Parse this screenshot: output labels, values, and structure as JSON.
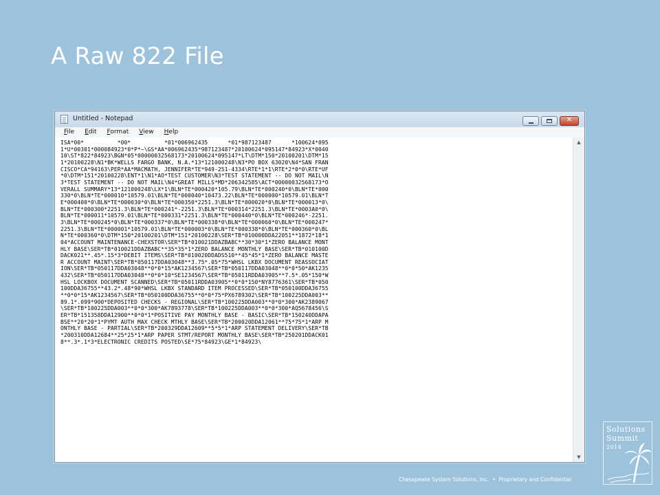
{
  "slide": {
    "title": "A Raw 822 File",
    "footer": {
      "company": "Chesapeake System Solutions, Inc.",
      "separator": "•",
      "note": "Proprietary and Confidential"
    },
    "logo": {
      "line1": "Solutions",
      "line2": "Summit",
      "year": "2014",
      "icon": "palm-tree-icon"
    },
    "background_color": "#9dc3dc"
  },
  "window": {
    "title": "Untitled - Notepad",
    "icons": {
      "app": "notepad-icon",
      "minimize": "minimize-icon",
      "maximize": "maximize-icon",
      "close": "close-icon"
    },
    "close_glyph": "✕",
    "menu": [
      {
        "accel": "F",
        "rest": "ile"
      },
      {
        "accel": "E",
        "rest": "dit"
      },
      {
        "accel": "F",
        "rest": "o",
        "after": "rmat",
        "accel_index": 1
      },
      {
        "accel": "V",
        "rest": "iew"
      },
      {
        "accel": "H",
        "rest": "elp"
      }
    ],
    "menu_labels": [
      "File",
      "Edit",
      "Format",
      "View",
      "Help"
    ],
    "scrollbar": {
      "up": "▲",
      "down": "▼"
    },
    "content_lines": [
      "ISA*00*          *00*          *01*006962435      *01*987123487      *100624*095",
      "1*U*00301*000084923*0*P*~\\GS*AA*006962435*987123487*20100624*095147*84923*X*0040",
      "10\\ST*822*84923\\BGN*05*00000032568173*20100624*095147*LT\\DTM*150*20100201\\DTM*15",
      "1*20100228\\N1*BK*WELLS FARGO BANK, N.A.*13*121000248\\N3*PO BOX 63020\\N4*SAN FRAN",
      "CISCO*CA*94163\\PER*AA*MACMATH, JENNIFER*TE*949-251-4334\\RTE*1*1\\RTE*2*0*0\\RTE*UF",
      "*0\\DTM*151*20100228\\ENT*1\\N1*AO*TEST CUSTOMER\\N3*TEST STATEMENT -- DO NOT MAIL\\N",
      "3*TEST STATEMENT -- DO NOT MAIL\\N4*GREAT MILLS*MD*206342585\\ACT*00000032568173*O",
      "VERALL SUMMARY*13*121000248\\LX*1\\BLN*TE*000420*105.79\\BLN*TE*000240*0\\BLN*TE*000",
      "330*0\\BLN*TE*000010*10579.01\\BLN*TE*000040*10473.22\\BLN*TE*000000*10579.01\\BLN*T",
      "E*000400*0\\BLN*TE*000030*0\\BLN*TE*000350*2251.3\\BLN*TE*000020*0\\BLN*TE*000013*0\\",
      "BLN*TE*000300*2251.3\\BLN*TE*000241*-2251.3\\BLN*TE*000314*2251.3\\BLN*TE*0003A0*0\\",
      "BLN*TE*000011*10579.01\\BLN*TE*000331*2251.3\\BLN*TE*000440*0\\BLN*TE*000246*-2251.",
      "3\\BLN*TE*000245*0\\BLN*TE*000337*0\\BLN*TE*000338*0\\BLN*TE*000060*0\\BLN*TE*000247*",
      "2251.3\\BLN*TE*000001*10579.01\\BLN*TE*000003*0\\BLN*TE*000338*0\\BLN*TE*000360*0\\BL",
      "N*TE*000360*0\\DTM*150*20100201\\DTM*151*20100228\\SER*TB*010000DDA22051**1872*18*1",
      "04*ACCOUNT MAINTENANCE-CHEXSTOR\\SER*TB*010021DDAZBABC**30*30*1*ZERO BALANCE MONT",
      "HLY BASE\\SER*TB*010021DDAZBABC**35*35*1*ZERO BALANCE MONTHLY BASE\\SER*TB*010100D",
      "DACK021**.45*.15*3*DEBIT ITEMS\\SER*TB*010020DDADS510**45*45*1*ZERO BALANCE MASTE",
      "R ACCOUNT MAINT\\SER*TB*050117DDA03048**3.75*.05*75*WHSL LKBX DOCUMENT REASSOCIAT",
      "ION\\SER*TB*050117DDA03048**0*0*15*AK1234567\\SER*TB*050117DDA03048**0*0*50*AK1235",
      "432\\SER*TB*050117DDA03048**0*0*10*SE1234567\\SER*TB*05011RDDA03905**7.5*.05*150*W",
      "HSL LOCKBOX DOCUMENT SCANNED\\SER*TB*05011RDDA03905**0*0*150*NY8776361\\SER*TB*050",
      "100DDA36755**43.2*.48*90*WHSL LKBX STANDARD ITEM PROCESSED\\SER*TB*050100DDA36755",
      "**0*0*15*AK1234567\\SER*TB*050100DDA36755**0*0*75*PX6789302\\SER*TB*100225DDA003**",
      "89.1*.099*900*DEPOSITED CHECKS - REGIONAL\\SER*TB*100225DDA003**0*0*300*AK2389067",
      "\\SER*TB*100225DDA003**0*0*300*AK7893778\\SER*TB*100225DDA003**0*0*300*AQ5678456\\S",
      "ER*TB*151358DDA12900**0*0*1*POSITIVE PAY MONTHLY BASE - BASIC\\SER*TB*150240DDAPA",
      "BSE**20*20*1*PYMT AUTH MAX CHECK MTHLY BASE\\SER*TB*200020DDA12061**75*75*1*ARP M",
      "ONTHLY BASE - PARTIAL\\SER*TB*200329DDA12609**5*5*1*ARP STATEMENT DELIVERY\\SER*TB",
      "*200310DDA12684**25*25*1*ARP PAPER STMT/REPORT MONTHLY BASE\\SER*TB*250201DDACK01",
      "8**.3*.1*3*ELECTRONIC CREDITS POSTED\\SE*75*84923\\GE*1*84923\\"
    ]
  }
}
